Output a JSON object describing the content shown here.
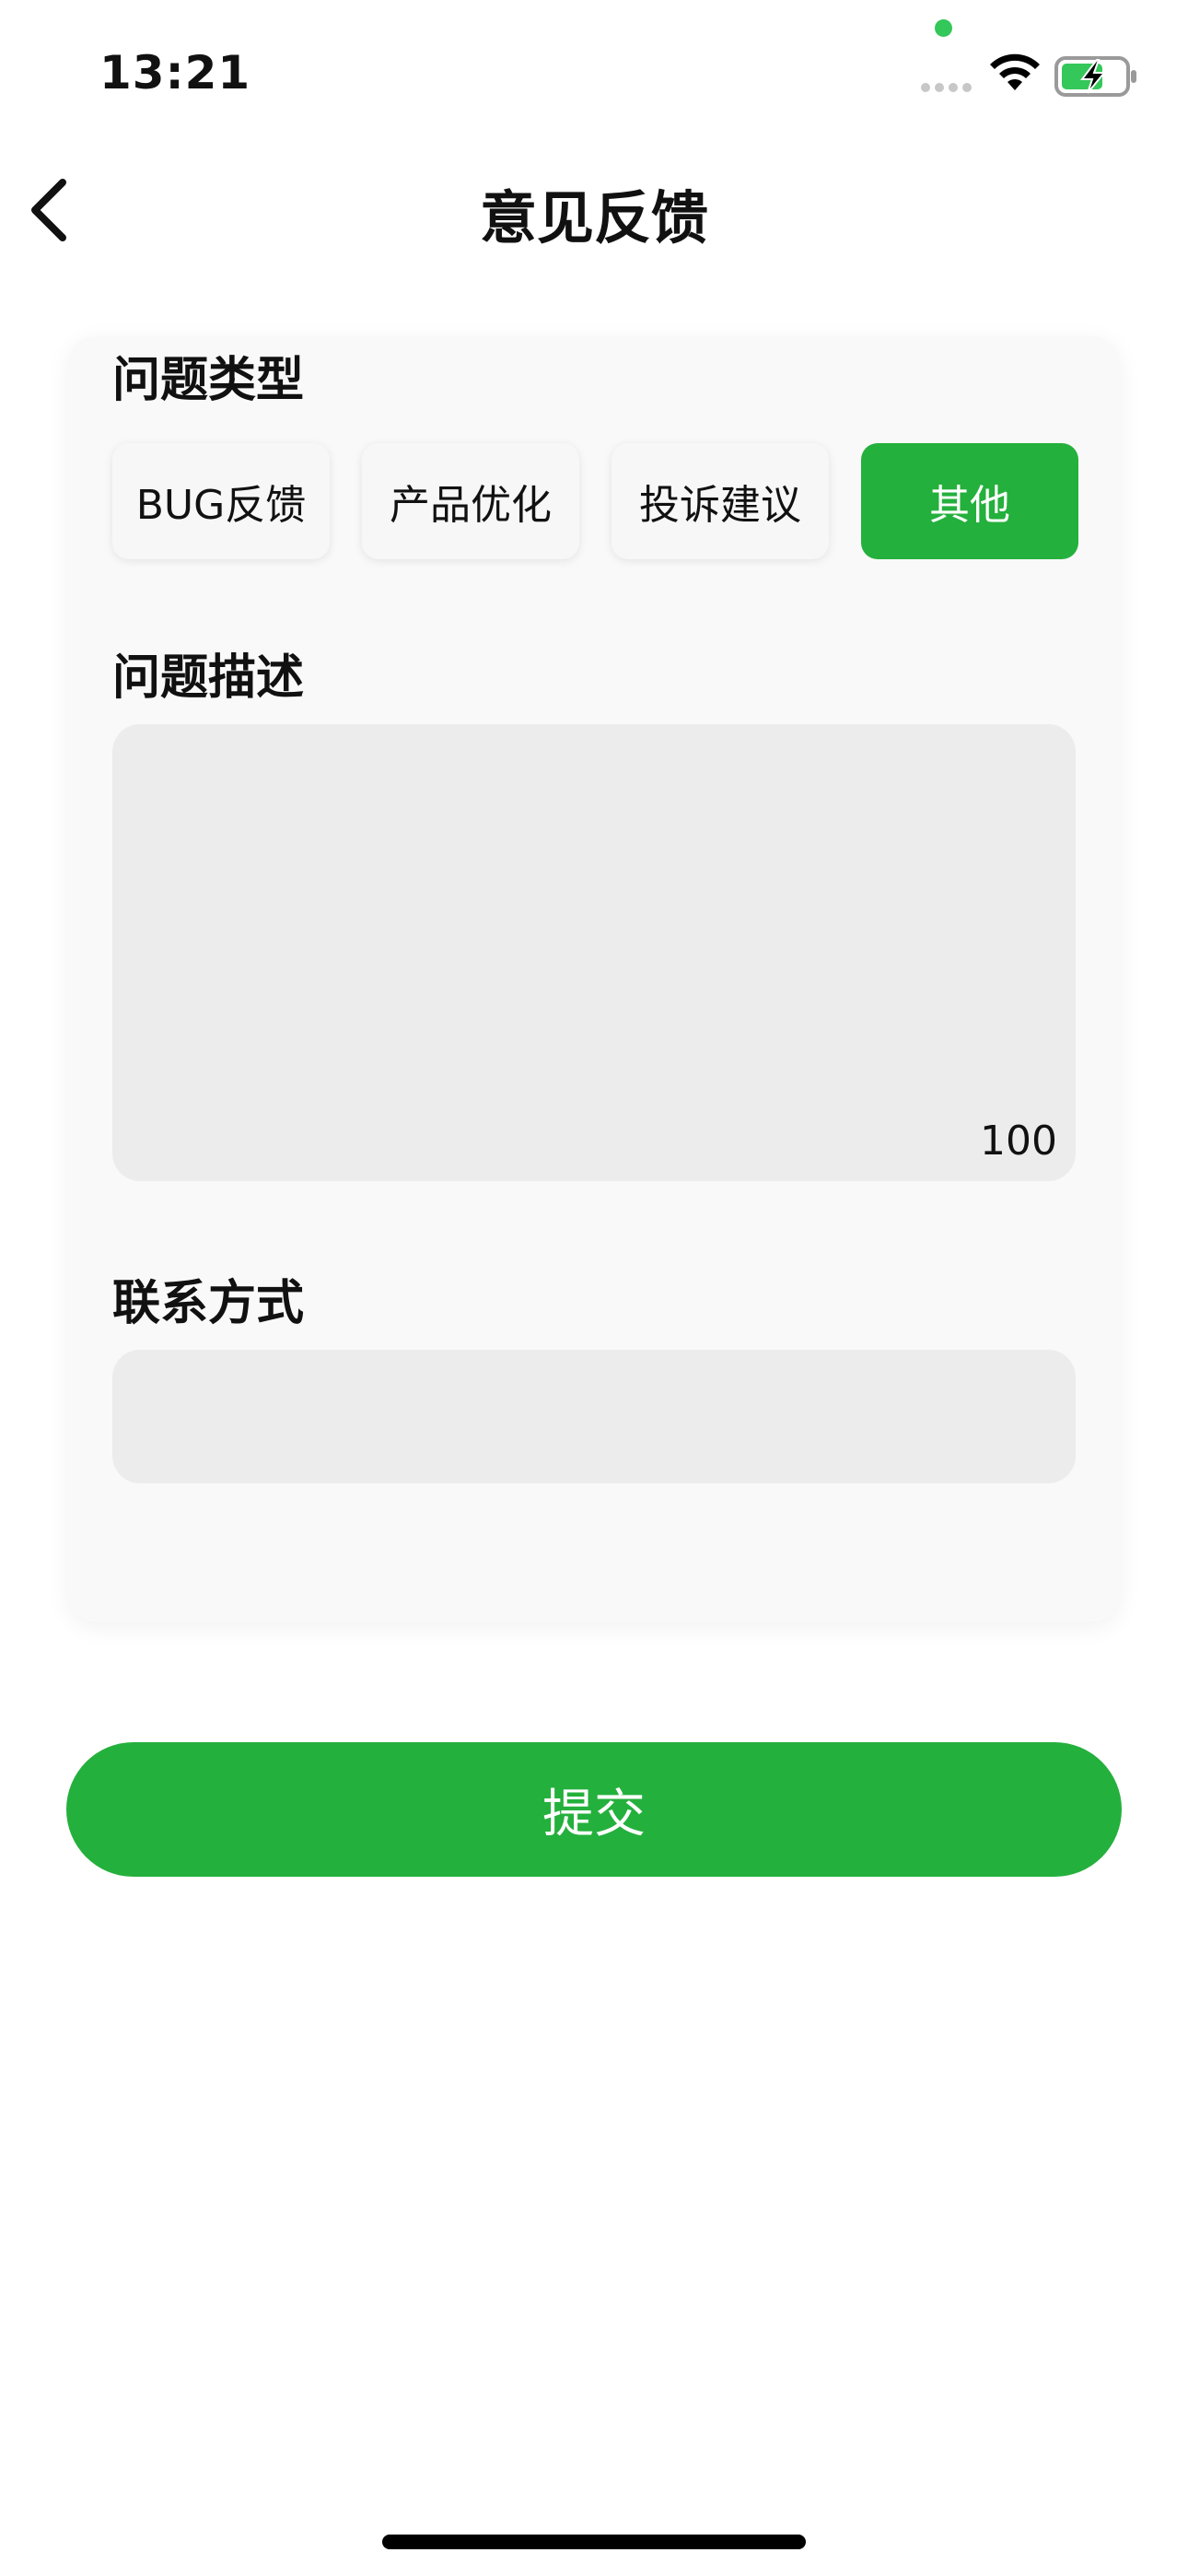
{
  "status_bar": {
    "time": "13:21",
    "icons": [
      "mic-indicator-dot",
      "cellular-icon",
      "wifi-icon",
      "battery-charging-icon"
    ],
    "colors": {
      "mic_dot": "#34c759",
      "battery_fill": "#34c759"
    }
  },
  "nav": {
    "back_icon": "chevron-left-icon",
    "title": "意见反馈"
  },
  "form": {
    "type_section": {
      "label": "问题类型",
      "options": [
        {
          "label": "BUG反馈",
          "selected": false
        },
        {
          "label": "产品优化",
          "selected": false
        },
        {
          "label": "投诉建议",
          "selected": false
        },
        {
          "label": "其他",
          "selected": true
        }
      ]
    },
    "description_section": {
      "label": "问题描述",
      "value": "",
      "char_count": "100"
    },
    "contact_section": {
      "label": "联系方式",
      "value": ""
    },
    "submit_label": "提交"
  },
  "colors": {
    "accent": "#24b03c",
    "input_bg": "#ececec",
    "card_bg": "#f9f9f9"
  }
}
